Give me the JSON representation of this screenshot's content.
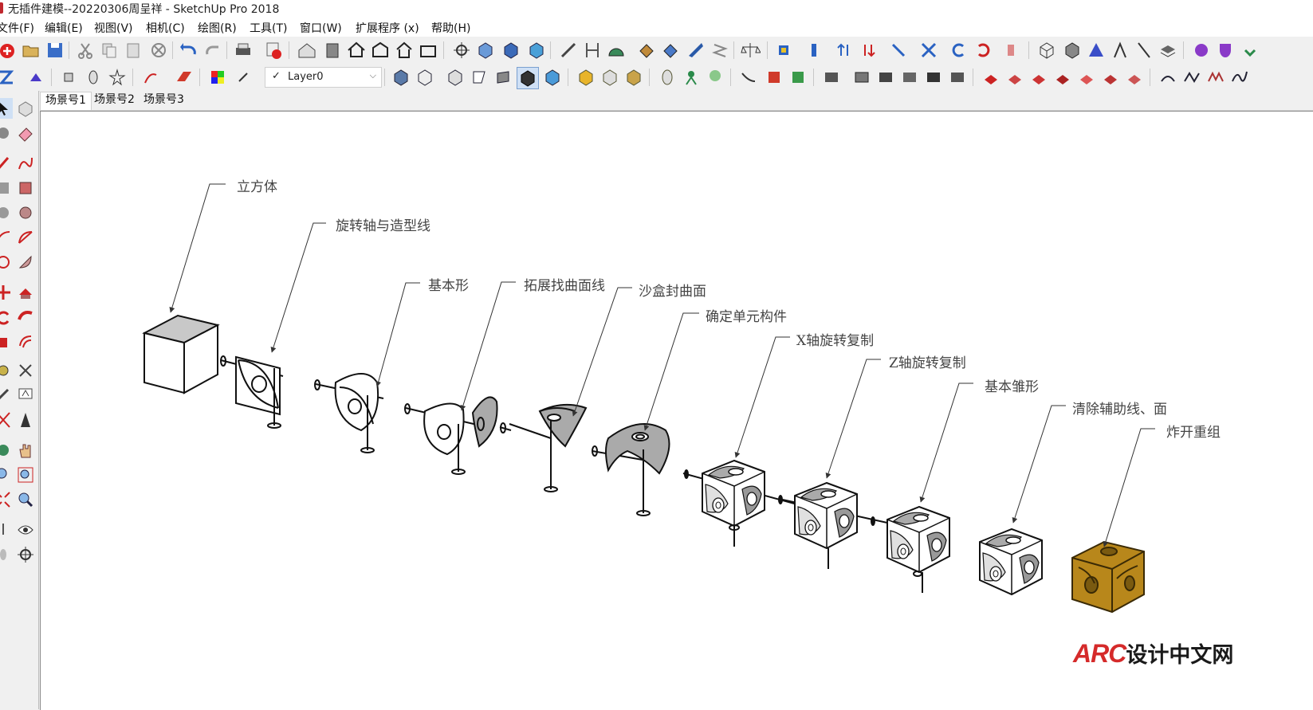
{
  "window": {
    "title": "无插件建模--20220306周呈祥 - SketchUp Pro 2018"
  },
  "menu": [
    {
      "label": "文件(F)"
    },
    {
      "label": "编辑(E)"
    },
    {
      "label": "视图(V)"
    },
    {
      "label": "相机(C)"
    },
    {
      "label": "绘图(R)"
    },
    {
      "label": "工具(T)"
    },
    {
      "label": "窗口(W)"
    },
    {
      "label": "扩展程序 (x)"
    },
    {
      "label": "帮助(H)"
    }
  ],
  "layer": {
    "current": "Layer0"
  },
  "scenes": [
    {
      "label": "场景号1",
      "active": true
    },
    {
      "label": "场景号2",
      "active": false
    },
    {
      "label": "场景号3",
      "active": false
    }
  ],
  "steps": [
    {
      "label": "立方体"
    },
    {
      "label": "旋转轴与造型线"
    },
    {
      "label": "基本形"
    },
    {
      "label": "拓展找曲面线"
    },
    {
      "label": "沙盒封曲面"
    },
    {
      "label": "确定单元构件"
    },
    {
      "label": "X轴旋转复制"
    },
    {
      "label": "Z轴旋转复制"
    },
    {
      "label": "基本雏形"
    },
    {
      "label": "清除辅助线、面"
    },
    {
      "label": "炸开重组"
    }
  ],
  "watermark": {
    "brand": "ARC",
    "text": "设计中文网"
  },
  "colors": {
    "viewport_bg": "#ffffff",
    "final_model": "#b8871b",
    "cube_top": "#c8c8c8",
    "label_text": "#444444"
  }
}
